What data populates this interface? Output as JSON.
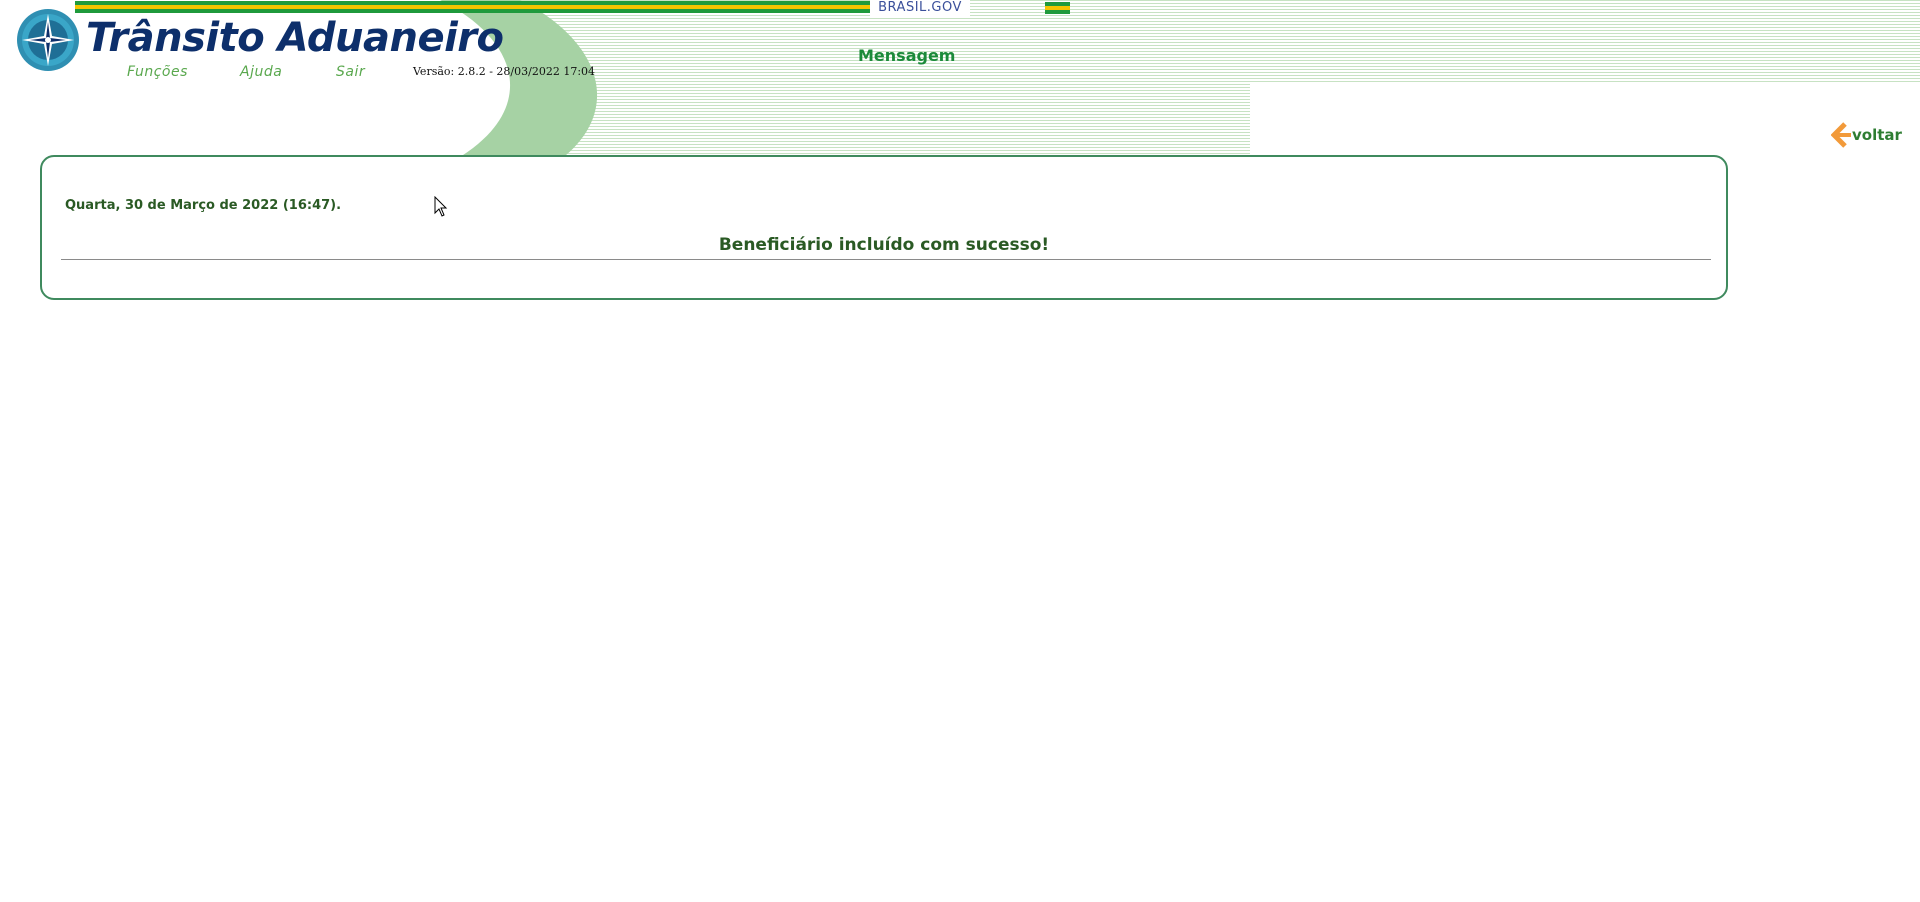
{
  "header": {
    "gov_label": "BRASIL.GOV",
    "app_title": "Trânsito Aduaneiro",
    "menu": [
      {
        "label": "Funções"
      },
      {
        "label": "Ajuda"
      },
      {
        "label": "Sair"
      }
    ],
    "version": "Versão: 2.8.2 - 28/03/2022 17:04",
    "page_title": "Mensagem"
  },
  "nav": {
    "back_label": "voltar",
    "back_icon": "arrow-left-icon"
  },
  "message": {
    "date": "Quarta, 30 de Março de 2022 (16:47).",
    "text": "Beneficiário incluído com sucesso!"
  },
  "colors": {
    "stripe_green": "#c7e2c3",
    "curve_green": "#a6d2a4",
    "title_navy": "#0d2f6b",
    "menu_green": "#5aa84e",
    "heading_green": "#1b8a3a",
    "text_green": "#2a5a24",
    "box_border": "#3f8a5e",
    "back_arrow_orange": "#f29a3a",
    "flag_green": "#1f9a3c",
    "flag_yellow": "#f4c400"
  }
}
